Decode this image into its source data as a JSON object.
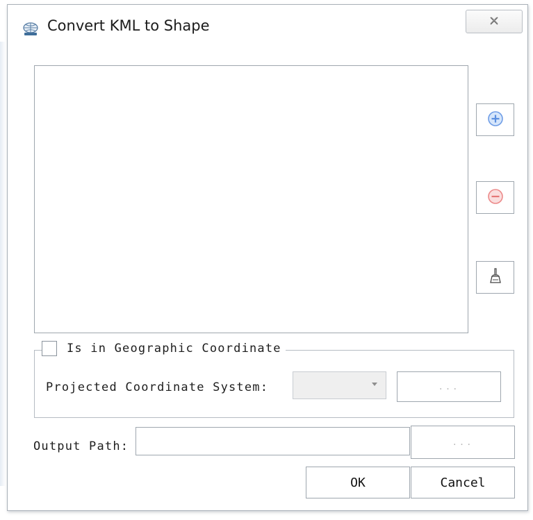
{
  "window": {
    "title": "Convert KML to Shape",
    "close_icon": "close-icon"
  },
  "file_list": {
    "items": []
  },
  "side_buttons": {
    "add_icon": "plus-circle-icon",
    "remove_icon": "minus-circle-icon",
    "clear_icon": "broom-icon"
  },
  "geographic": {
    "checkbox_label": "Is in Geographic Coordinate",
    "checked": false,
    "projected_label": "Projected Coordinate System:",
    "projected_value": "",
    "browse_label": "..."
  },
  "output": {
    "label": "Output Path:",
    "value": "",
    "browse_label": "..."
  },
  "actions": {
    "ok_label": "OK",
    "cancel_label": "Cancel"
  },
  "colors": {
    "add_accent": "#6f9de6",
    "remove_accent": "#ec8a8a",
    "border": "#9ea6ae"
  }
}
